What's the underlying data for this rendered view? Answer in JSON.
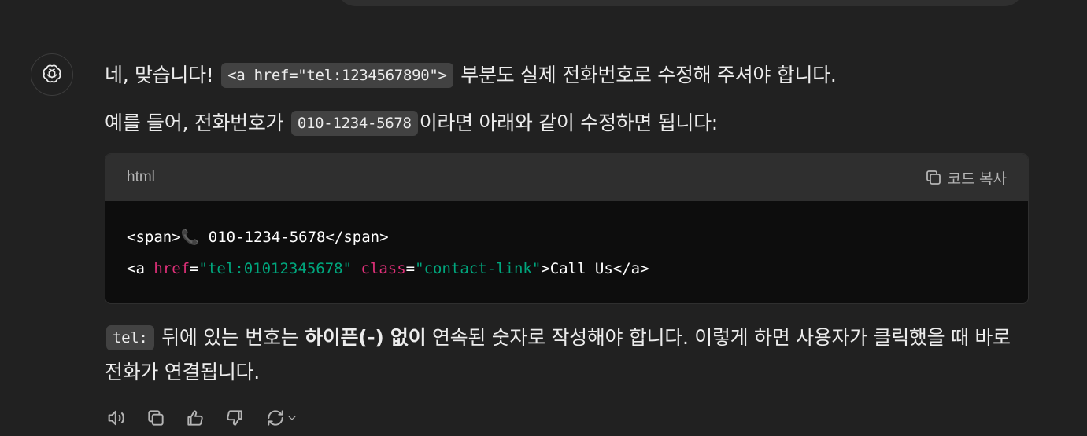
{
  "message": {
    "p1_prefix": "네, 맞습니다! ",
    "p1_code": "<a href=\"tel:1234567890\">",
    "p1_suffix": " 부분도 실제 전화번호로 수정해 주셔야 합니다.",
    "p2_prefix": "예를 들어, 전화번호가 ",
    "p2_code": "010-1234-5678",
    "p2_suffix": "이라면 아래와 같이 수정하면 됩니다:",
    "p3_code": "tel:",
    "p3_text1": " 뒤에 있는 번호는 ",
    "p3_bold": "하이픈(-) 없이",
    "p3_text2": " 연속된 숫자로 작성해야 합니다. 이렇게 하면 사용자가 클릭했을 때 바로 전화가 연결됩니다."
  },
  "code_block": {
    "language": "html",
    "copy_label": "코드 복사",
    "line1_open": "<span>",
    "line1_emoji": "📞",
    "line1_rest": " 010-1234-5678</span>",
    "line2_tag_open": "<a ",
    "line2_attr1": "href",
    "line2_eq1": "=",
    "line2_val1": "\"tel:01012345678\"",
    "line2_space": " ",
    "line2_attr2": "class",
    "line2_eq2": "=",
    "line2_val2": "\"contact-link\"",
    "line2_close": ">Call Us</a>"
  },
  "actions": [
    "speaker-icon",
    "copy-icon",
    "thumbs-up-icon",
    "thumbs-down-icon",
    "regenerate-icon"
  ],
  "colors": {
    "background": "#212121",
    "code_bg": "#0d0d0d",
    "attr": "#df3079",
    "string": "#00a67d"
  }
}
